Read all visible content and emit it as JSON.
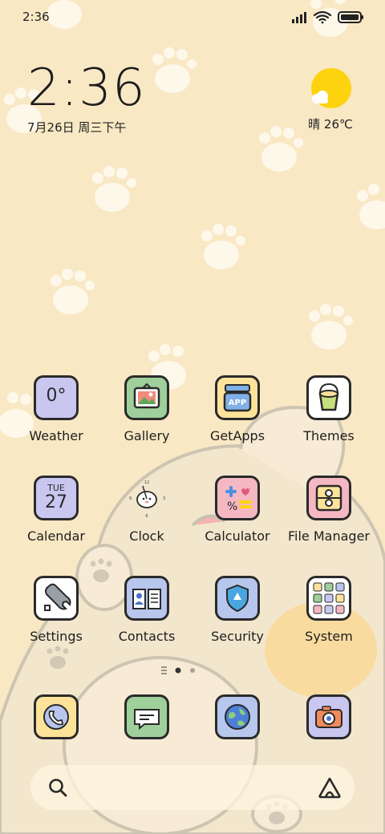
{
  "status_bar": {
    "time": "2:36"
  },
  "clock_widget": {
    "time": "2:36",
    "date": "7月26日 周三下午"
  },
  "weather_widget": {
    "text": "晴 26℃"
  },
  "apps": [
    {
      "label": "Weather",
      "icon": "weather-icon",
      "glyph": "0°",
      "color": "#c9c7f0"
    },
    {
      "label": "Gallery",
      "icon": "gallery-icon",
      "color": "#9fcf9a"
    },
    {
      "label": "GetApps",
      "icon": "getapps-icon",
      "color": "#fde39a"
    },
    {
      "label": "Themes",
      "icon": "themes-icon",
      "color": "#ffffff"
    },
    {
      "label": "Calendar",
      "icon": "calendar-icon",
      "day": "TUE",
      "date": "27",
      "color": "#c9c7f0"
    },
    {
      "label": "Clock",
      "icon": "clock-icon",
      "color": "#ffffff"
    },
    {
      "label": "Calculator",
      "icon": "calculator-icon",
      "color": "#f5b8c3"
    },
    {
      "label": "File Manager",
      "icon": "file-manager-icon",
      "color": "#f5b8c3"
    },
    {
      "label": "Settings",
      "icon": "settings-icon",
      "color": "#ffffff"
    },
    {
      "label": "Contacts",
      "icon": "contacts-icon",
      "color": "#b7c6ec"
    },
    {
      "label": "Security",
      "icon": "security-icon",
      "color": "#b7c6ec"
    },
    {
      "label": "System",
      "icon": "system-folder-icon",
      "color": "#ffffff"
    }
  ],
  "dock": [
    {
      "icon": "phone-icon",
      "color": "#fde39a"
    },
    {
      "icon": "messages-icon",
      "color": "#9fcf9a"
    },
    {
      "icon": "browser-icon",
      "color": "#b7c6ec"
    },
    {
      "icon": "camera-icon",
      "color": "#c9c7f0"
    }
  ],
  "search_bar": {
    "search_icon": "search-icon",
    "assistant_icon": "assistant-icon"
  }
}
